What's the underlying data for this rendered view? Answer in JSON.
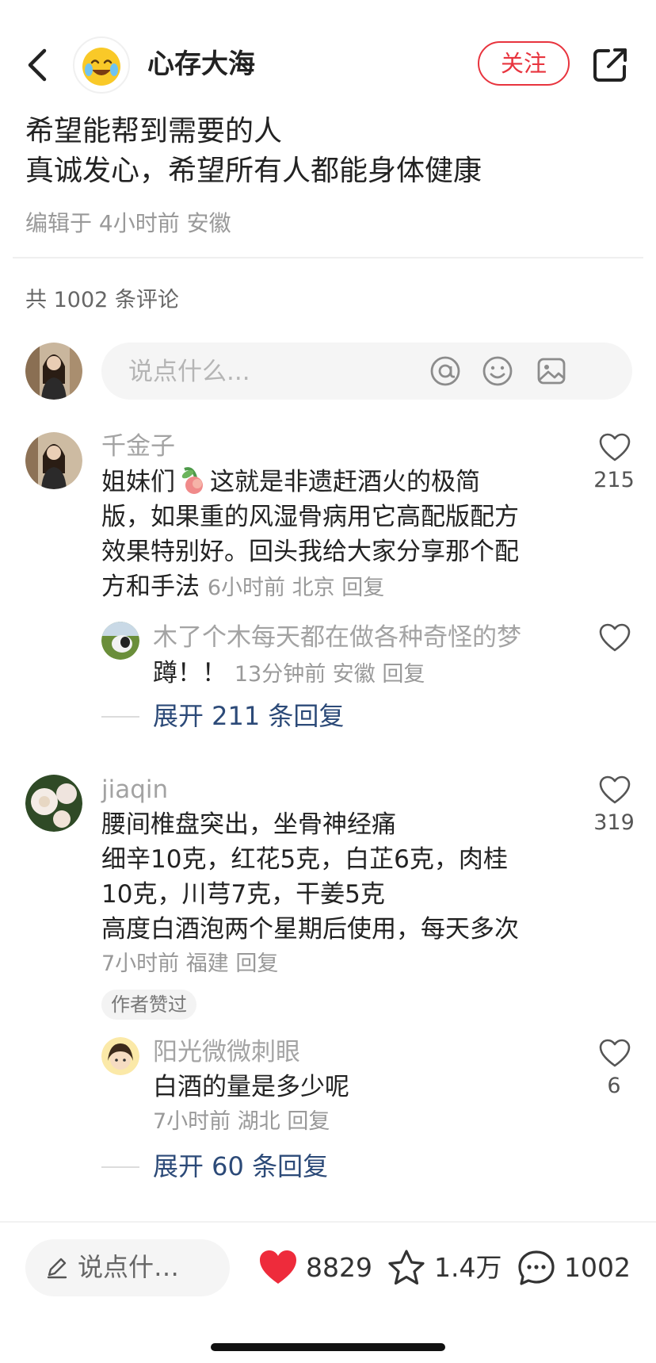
{
  "header": {
    "author_name": "心存大海",
    "follow_label": "关注"
  },
  "post": {
    "lines": [
      "希望能帮到需要的人",
      "真诚发心，希望所有人都能身体健康"
    ],
    "meta": "编辑于 4小时前 安徽"
  },
  "comments_header": {
    "count_label": "共 1002 条评论",
    "input_placeholder": "说点什么..."
  },
  "comments": [
    {
      "user": "千金子",
      "text_lines": [
        "姐妹们",
        "这就是非遗赶酒火的极简",
        "版，如果重的风湿骨病用它高配版配方",
        "效果特别好。回头我给大家分享那个配",
        "方和手法"
      ],
      "meta": "6小时前 北京 回复",
      "likes": "215",
      "reply": {
        "user": "木了个木每天都在做各种奇怪的梦",
        "text": "蹲！！",
        "meta": "13分钟前 安徽 回复"
      },
      "expand_label": "展开 211 条回复"
    },
    {
      "user": "jiaqin",
      "text_lines": [
        "腰间椎盘突出，坐骨神经痛",
        "细辛10克，红花5克，白芷6克，肉桂",
        "10克，川芎7克，干姜5克",
        "高度白酒泡两个星期后使用，每天多次"
      ],
      "meta": "7小时前 福建 回复",
      "likes": "319",
      "badge": "作者赞过",
      "reply": {
        "user": "阳光微微刺眼",
        "text": "白酒的量是多少呢",
        "meta": "7小时前 湖北 回复",
        "likes": "6"
      },
      "expand_label": "展开 60 条回复"
    }
  ],
  "bottom_bar": {
    "input_label": "说点什…",
    "likes": "8829",
    "collects": "1.4万",
    "comments": "1002",
    "like_color": "#ee2b3b"
  },
  "icons": [
    "back-icon",
    "share-icon",
    "at-icon",
    "emoji-icon",
    "image-icon",
    "heart-outline-icon",
    "heart-filled-icon",
    "star-icon",
    "comment-bubble-icon",
    "pencil-icon",
    "peach-emoji-icon"
  ]
}
